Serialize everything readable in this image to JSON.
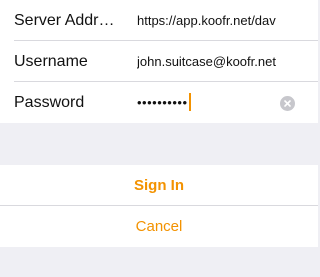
{
  "form": {
    "server_label": "Server Addr…",
    "server_value": "https://app.koofr.net/dav",
    "username_label": "Username",
    "username_value": "john.suitcase@koofr.net",
    "password_label": "Password",
    "password_value": "••••••••••"
  },
  "actions": {
    "sign_in_label": "Sign In",
    "cancel_label": "Cancel"
  },
  "colors": {
    "accent": "#f39200",
    "background": "#efeff4",
    "cell": "#ffffff",
    "separator": "#d9d9de",
    "clear_icon": "#c7c7cc"
  },
  "icons": {
    "clear": "clear-x-circle-icon"
  }
}
